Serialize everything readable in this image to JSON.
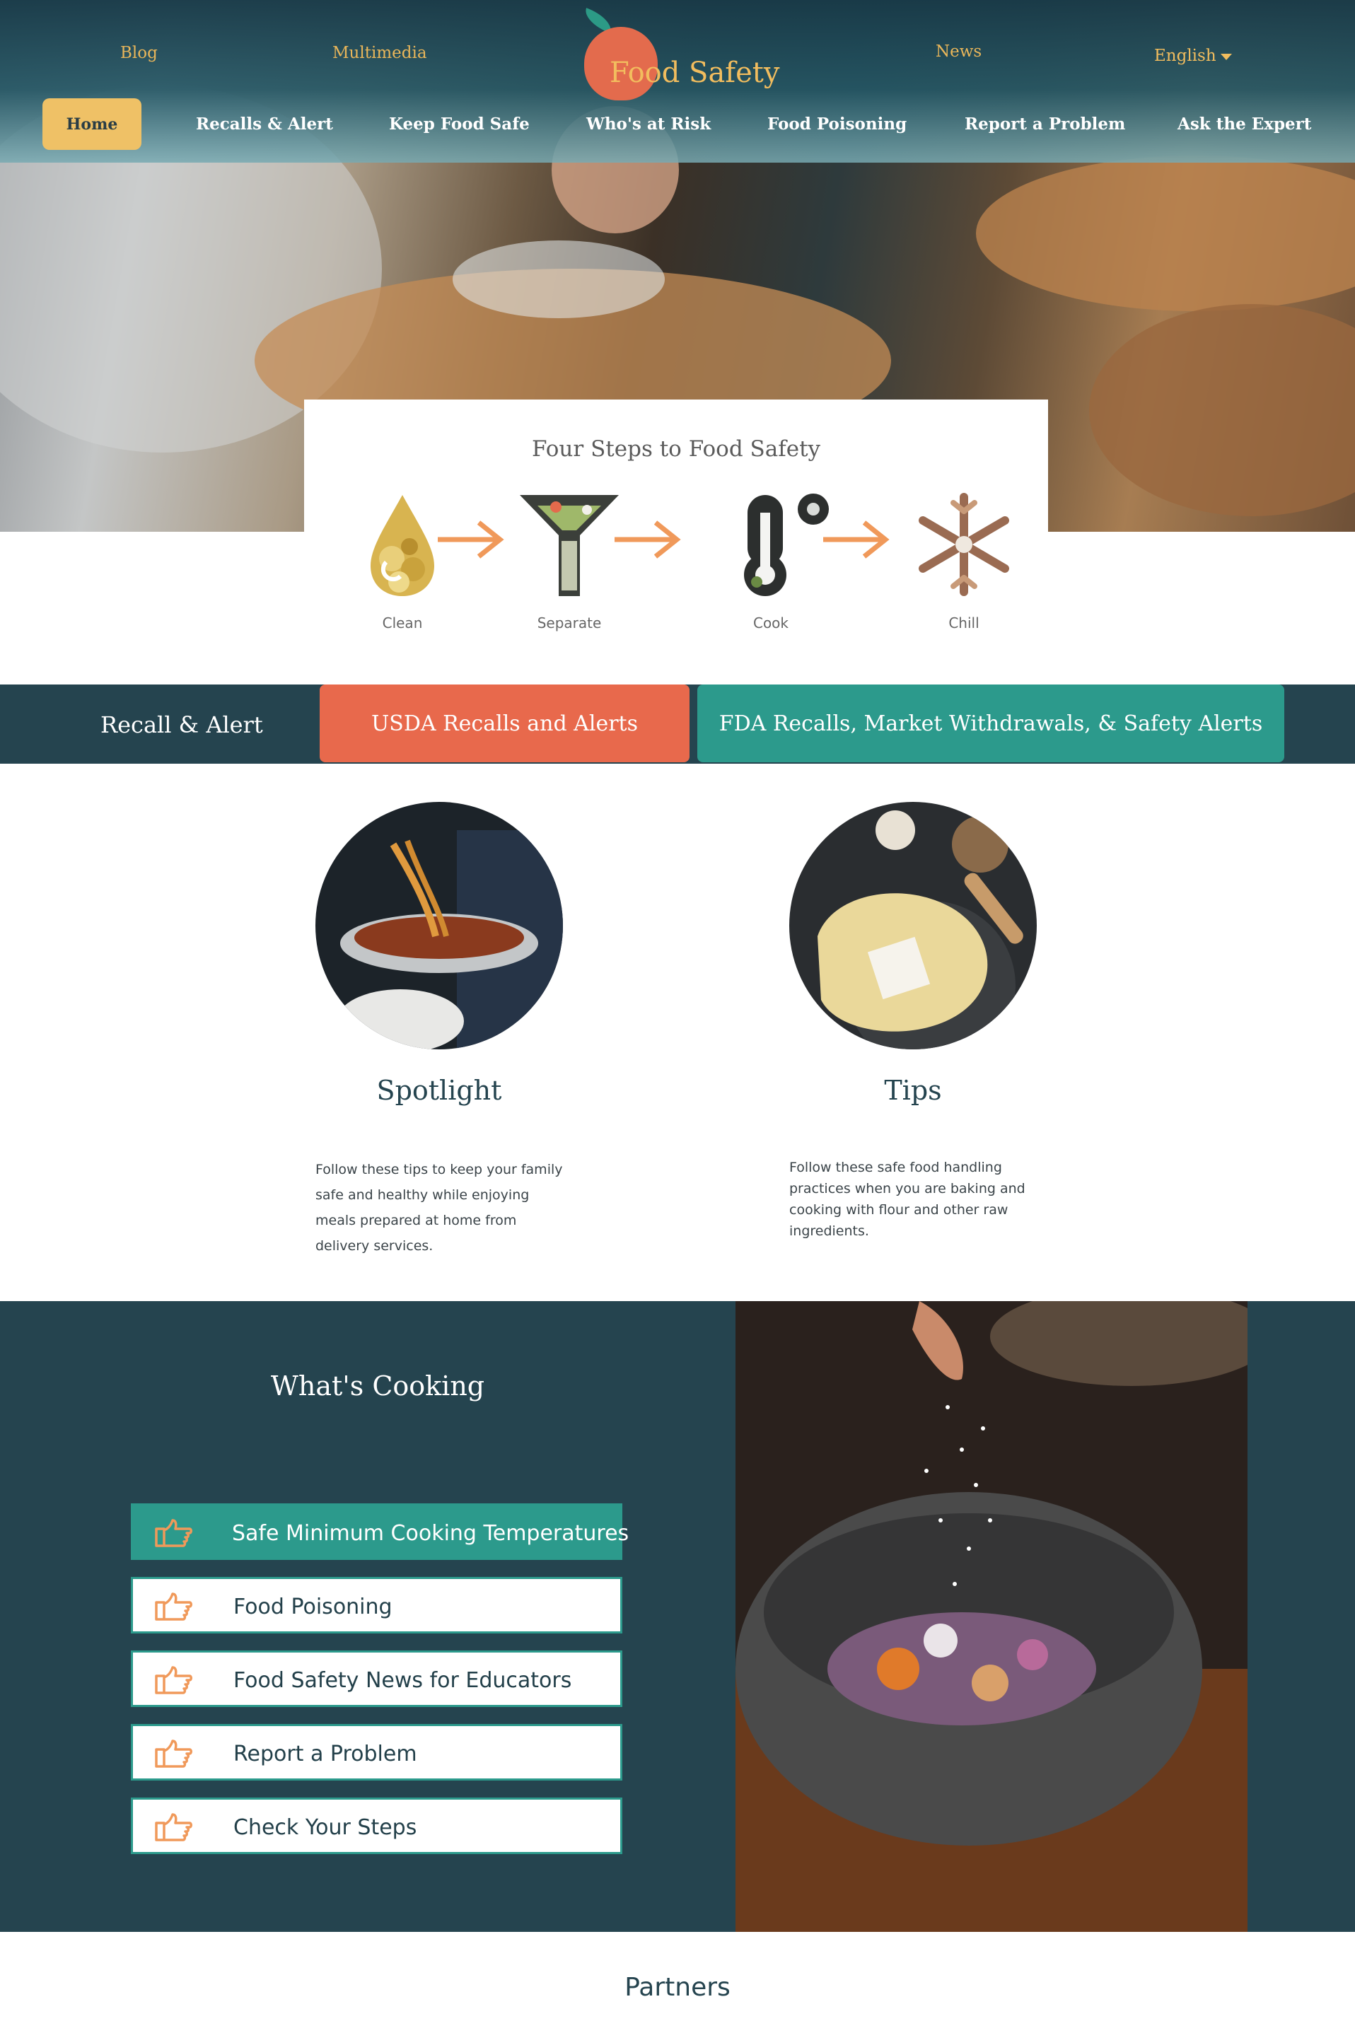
{
  "header": {
    "top_links": [
      "Blog",
      "Multimedia",
      "News"
    ],
    "logo_text": "Food Safety",
    "language": "English"
  },
  "nav": {
    "home": "Home",
    "items": [
      "Recalls & Alert",
      "Keep Food Safe",
      "Who's at Risk",
      "Food Poisoning",
      "Report a Problem",
      "Ask the Expert"
    ]
  },
  "steps": {
    "title": "Four Steps to Food Safety",
    "items": [
      {
        "label": "Clean",
        "icon": "water-drop-icon"
      },
      {
        "label": "Separate",
        "icon": "funnel-icon"
      },
      {
        "label": "Cook",
        "icon": "thermometer-icon"
      },
      {
        "label": "Chill",
        "icon": "snowflake-icon"
      }
    ],
    "arrow_color": "#f0995a"
  },
  "recall": {
    "title": "Recall & Alert",
    "usda": "USDA Recalls and Alerts",
    "fda": "FDA Recalls, Market Withdrawals, & Safety Alerts"
  },
  "cards": [
    {
      "title": "Spotlight",
      "text": "Follow these tips to keep your family safe and healthy while enjoying meals prepared at home from delivery services."
    },
    {
      "title": "Tips",
      "text": "Follow these safe food handling practices when you are baking and cooking with flour and other raw ingredients."
    }
  ],
  "cooking": {
    "title": "What's Cooking",
    "items": [
      "Safe Minimum Cooking Temperatures",
      "Food Poisoning",
      "Food Safety News for Educators",
      "Report a Problem",
      "Check Your Steps"
    ]
  },
  "partners": {
    "title": "Partners"
  },
  "colors": {
    "navy": "#25444f",
    "coral": "#e8694c",
    "teal": "#2c9a8c",
    "gold": "#efc166"
  }
}
